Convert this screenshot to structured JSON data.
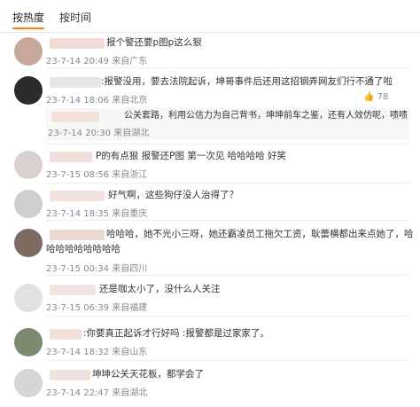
{
  "tabs": [
    "按热度",
    "按时间"
  ],
  "comments": [
    {
      "text": "报个警还要p图p这么狠",
      "meta": "23-7-14 20:49 来自广东"
    },
    {
      "text": ":报警没用，要去法院起诉，坤哥事件后还用这招钢弄网友们行不通了啦",
      "meta": "23-7-14 18:06 来自北京",
      "likes": "78"
    },
    {
      "text": "公关套路，利用公信力为自己背书，坤坤前车之鉴，还有人效仿呢，啧啧",
      "meta": "23-7-14 20:30 来自湖北"
    },
    {
      "text": "P的有点狠 报警还P图 第一次见 哈哈哈哈 好笑",
      "meta": "23-7-15 08:56 来自浙江"
    },
    {
      "text": "好气啊，这些狗仔没人治得了？",
      "meta": "23-7-14 18:35 来自重庆"
    },
    {
      "text_line1": "哈哈哈，她不光小三呀，她还霸凌员工拖欠工资，耿蕾横都出来点她了，哈",
      "text_line2": "哈哈哈哈哈哈哈哈",
      "meta": "23-7-15 00:34 来自四川"
    },
    {
      "text": "还是咖太小了，没什么人关注",
      "meta": "23-7-15 06:39 来自福建"
    },
    {
      "text": ":你要真正起诉才行好吗 :报警都是过家家了。",
      "meta": "23-7-14 18:32 来自山东"
    },
    {
      "text": "坤坤公关天花板，都学会了",
      "meta": "23-7-14 22:47 来自湖北"
    }
  ],
  "colors": {
    "accent": "#ff8200",
    "meta": "#888888",
    "separator": "#eeeeee"
  }
}
